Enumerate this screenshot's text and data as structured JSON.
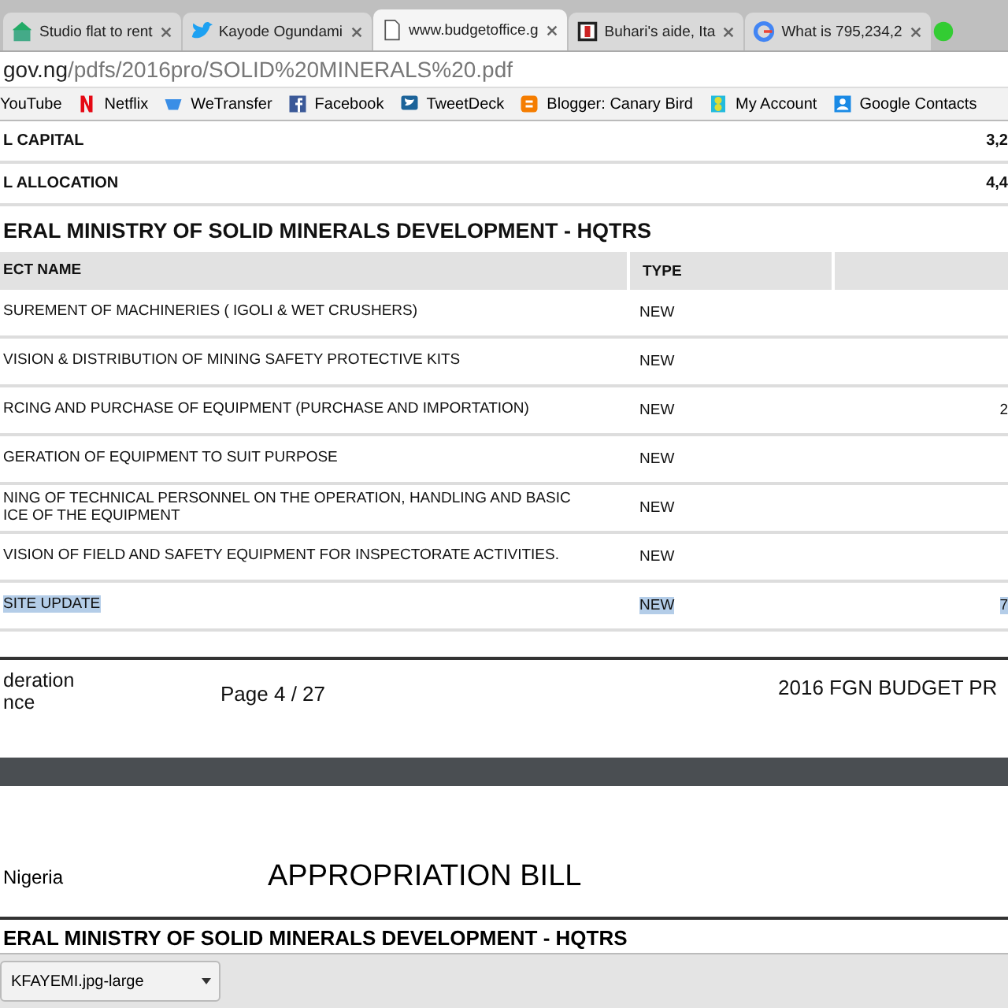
{
  "tabs": [
    {
      "title": "Studio flat to rent",
      "selected": false
    },
    {
      "title": "Kayode Ogundami",
      "selected": false
    },
    {
      "title": "www.budgetoffice.g",
      "selected": true
    },
    {
      "title": "Buhari's aide, Ita",
      "selected": false
    },
    {
      "title": "What is 795,234,2",
      "selected": false
    }
  ],
  "address": {
    "host": "gov.ng",
    "path": "/pdfs/2016pro/SOLID%20MINERALS%20.pdf"
  },
  "bookmarks": [
    {
      "label": "YouTube"
    },
    {
      "label": "Netflix"
    },
    {
      "label": "WeTransfer"
    },
    {
      "label": "Facebook"
    },
    {
      "label": "TweetDeck"
    },
    {
      "label": "Blogger: Canary Bird"
    },
    {
      "label": "My Account"
    },
    {
      "label": "Google Contacts"
    }
  ],
  "totals": [
    {
      "label": "L CAPITAL",
      "value": "3,2"
    },
    {
      "label": "L ALLOCATION",
      "value": "4,4"
    }
  ],
  "section_title": "ERAL MINISTRY OF SOLID MINERALS DEVELOPMENT - HQTRS",
  "table": {
    "columns": [
      "ECT NAME",
      "TYPE"
    ],
    "rows": [
      {
        "name": "SUREMENT OF MACHINERIES ( IGOLI & WET CRUSHERS)",
        "type": "NEW",
        "amount": "",
        "highlighted": false
      },
      {
        "name": "VISION & DISTRIBUTION OF MINING SAFETY PROTECTIVE KITS",
        "type": "NEW",
        "amount": "",
        "highlighted": false
      },
      {
        "name": "RCING AND PURCHASE OF EQUIPMENT (PURCHASE AND IMPORTATION)",
        "type": "NEW",
        "amount": "2",
        "highlighted": false
      },
      {
        "name": "GERATION OF EQUIPMENT TO SUIT PURPOSE",
        "type": "NEW",
        "amount": "",
        "highlighted": false
      },
      {
        "name": "NING OF TECHNICAL PERSONNEL ON THE OPERATION, HANDLING AND BASIC\nICE OF THE EQUIPMENT",
        "type": "NEW",
        "amount": "",
        "highlighted": false
      },
      {
        "name": "VISION OF FIELD AND SAFETY EQUIPMENT FOR INSPECTORATE ACTIVITIES.",
        "type": "NEW",
        "amount": "",
        "highlighted": false
      },
      {
        "name": "SITE UPDATE",
        "type": "NEW",
        "amount": "7",
        "highlighted": true
      }
    ]
  },
  "footer": {
    "left": "deration\nnce",
    "page": "Page 4  / 27",
    "right": "2016 FGN BUDGET PR"
  },
  "next_page": {
    "left": "Nigeria",
    "title": "APPROPRIATION BILL",
    "section_title": "ERAL MINISTRY OF SOLID MINERALS DEVELOPMENT - HQTRS"
  },
  "download": {
    "file": "KFAYEMI.jpg-large"
  }
}
